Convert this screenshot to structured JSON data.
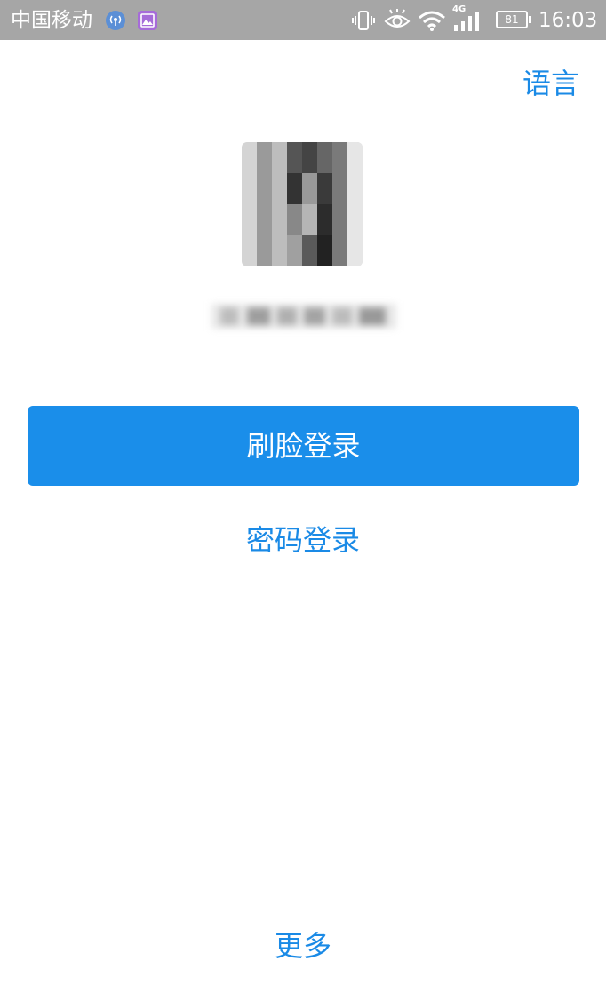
{
  "status_bar": {
    "carrier": "中国移动",
    "network_type": "4G",
    "battery": "81",
    "time": "16:03",
    "icons": [
      "hotspot-icon",
      "gallery-icon",
      "vibrate-icon",
      "eye-icon",
      "wifi-icon",
      "signal-icon",
      "battery-icon"
    ]
  },
  "header": {
    "language_label": "语言"
  },
  "profile": {
    "avatar_icon": "avatar-pixelated",
    "username": ""
  },
  "actions": {
    "face_login_label": "刷脸登录",
    "password_login_label": "密码登录",
    "more_label": "更多"
  },
  "colors": {
    "accent": "#1a8eea",
    "status_bar": "#a6a6a6",
    "background": "#ffffff"
  }
}
